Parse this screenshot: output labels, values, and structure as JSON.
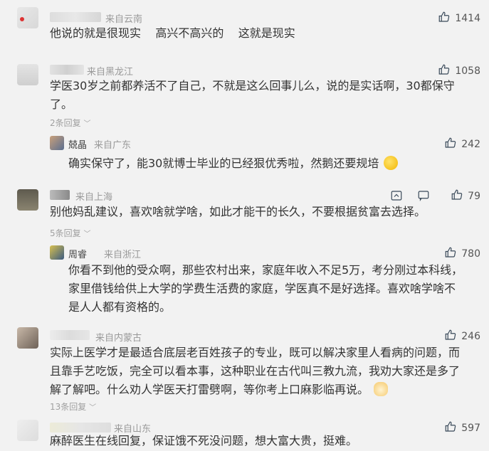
{
  "comments": [
    {
      "location": "来自云南",
      "likes": "1414",
      "text": "他说的就是很现实    高兴不高兴的    这就是现实"
    },
    {
      "location": "来自黑龙江",
      "likes": "1058",
      "text_line1": "学医30岁之前都养活不了自己，不就是这么回事儿么，说的是实话啊，30都保守",
      "text_line2": "了。",
      "replies": "2条回复",
      "reply": {
        "name": "兢晶",
        "location": "来自广东",
        "likes": "242",
        "text": "确实保守了，能30就博士毕业的已经狠优秀啦，然鹅还要规培"
      }
    },
    {
      "location": "来自上海",
      "likes": "79",
      "text": "别他妈乱建议，喜欢啥就学啥，如此才能干的长久，不要根据贫富去选择。",
      "replies": "5条回复",
      "reply": {
        "name": "周睿",
        "location": "来自浙江",
        "likes": "780",
        "text_line1": "你看不到他的受众啊，那些农村出来，家庭年收入不足5万，考分刚过本科线，",
        "text_line2": "家里借钱给供上大学的学费生活费的家庭，学医真不是好选择。喜欢啥学啥不",
        "text_line3": "是人人都有资格的。"
      }
    },
    {
      "location": "来自内蒙古",
      "likes": "246",
      "text_line1": "实际上医学才是最适合底层老百姓孩子的专业，既可以解决家里人看病的问题，而",
      "text_line2": "且靠手艺吃饭，完全可以看本事，这种职业在古代叫三教九流，我劝大家还是多了",
      "text_line3": "解了解吧。什么劝人学医天打雷劈啊，等你考上口麻影临再说。",
      "replies": "13条回复"
    },
    {
      "location": "来自山东",
      "likes": "597",
      "text": "麻醉医生在线回复，保证饿不死没问题，想大富大贵，挺难。"
    }
  ],
  "icons": [
    "thumbs-up-icon",
    "share-icon",
    "comment-icon",
    "chevron-down-icon",
    "laugh-emoji-icon",
    "cat-emoji-icon"
  ]
}
